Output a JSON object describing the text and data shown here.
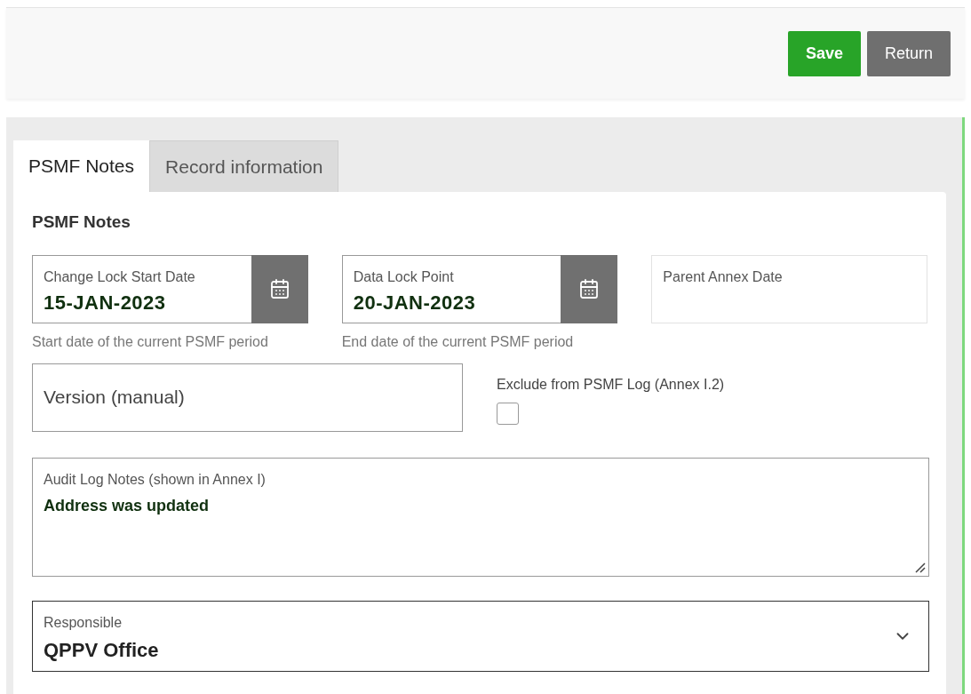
{
  "toolbar": {
    "buttons": [
      {
        "label": "Save",
        "kind": "primary"
      },
      {
        "label": "Return",
        "kind": "secondary"
      }
    ]
  },
  "tabs": [
    {
      "label": "PSMF Notes",
      "selected": true
    },
    {
      "label": "Record information",
      "selected": false
    }
  ],
  "section": {
    "title": "PSMF Notes",
    "date_fields": [
      {
        "label": "Change Lock Start Date",
        "value": "15-JAN-2023",
        "hint": "Start date of the current PSMF period",
        "has_picker": true
      },
      {
        "label": "Data Lock Point",
        "value": "20-JAN-2023",
        "hint": "End date of the current PSMF period",
        "has_picker": true
      },
      {
        "label": "Parent Annex Date",
        "has_picker": false
      }
    ],
    "version": {
      "placeholder": "Version (manual)"
    },
    "exclude": {
      "label": "Exclude from PSMF Log (Annex I.2)",
      "checked": false
    },
    "notes": {
      "label": "Audit Log Notes (shown in Annex I)",
      "value": "Address was updated"
    },
    "responsible": {
      "label": "Responsible",
      "value": "QPPV Office"
    }
  }
}
